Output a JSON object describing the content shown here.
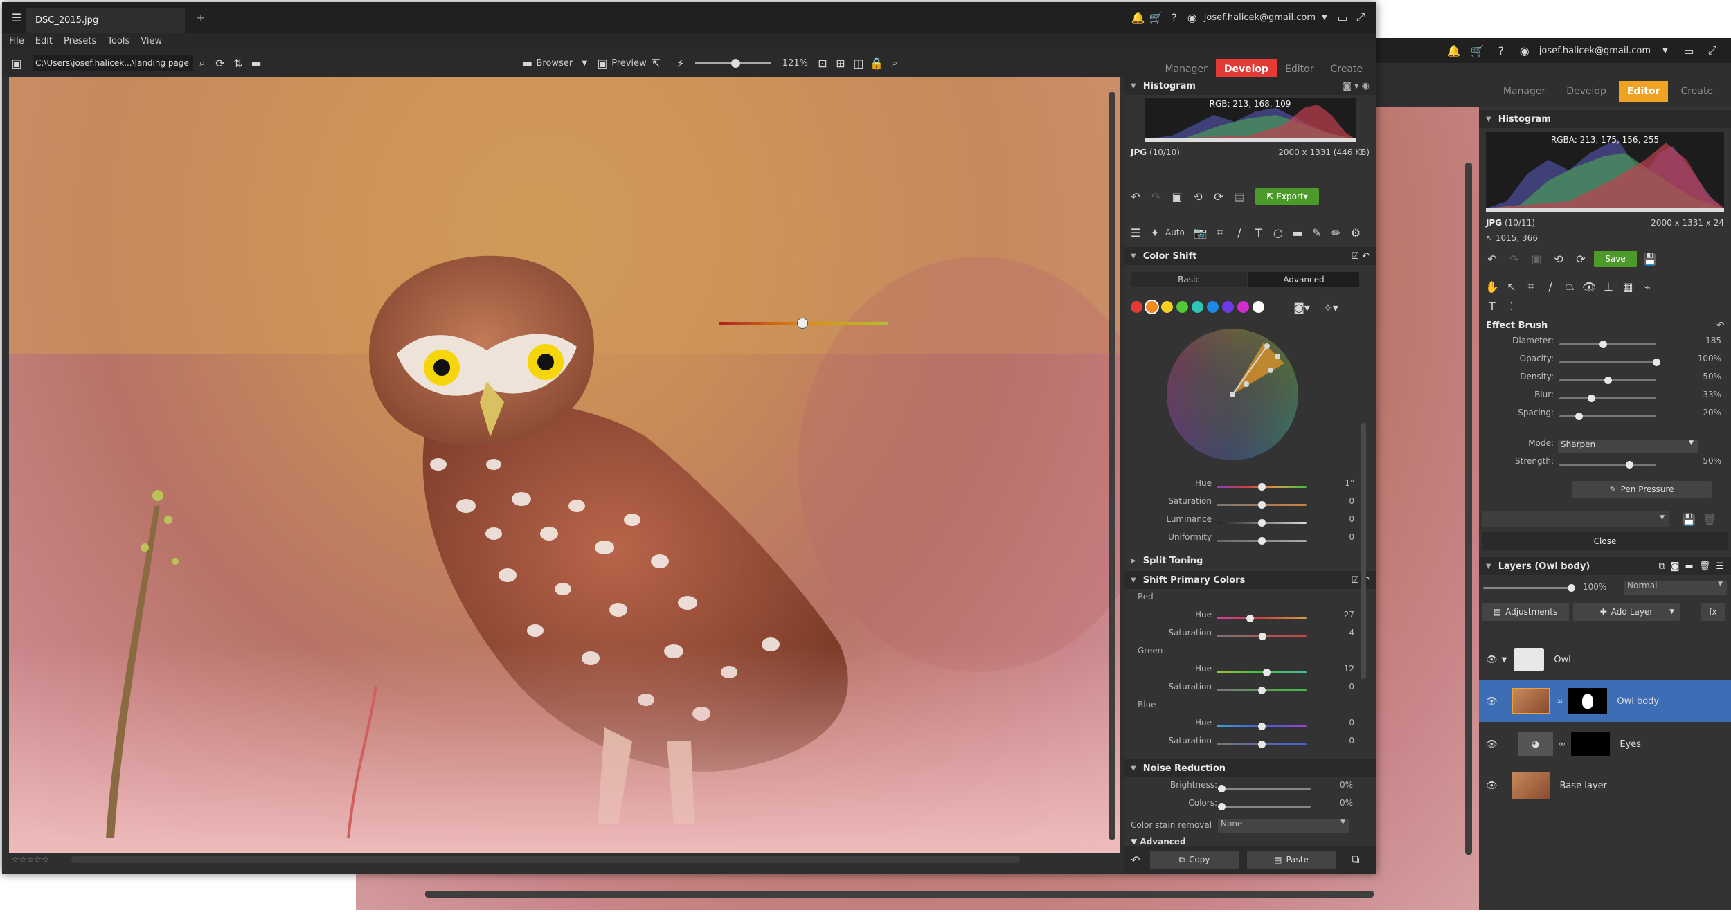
{
  "front": {
    "tab_title": "DSC_2015.jpg",
    "menu": [
      "File",
      "Edit",
      "Presets",
      "Tools",
      "View"
    ],
    "path": "C:\\Users\\josef.halicek...\\landing page",
    "browser_label": "Browser",
    "preview_label": "Preview",
    "zoom": "121%",
    "user": "josef.halicek@gmail.com",
    "modes": [
      "Manager",
      "Develop",
      "Editor",
      "Create"
    ],
    "histogram": {
      "title": "Histogram",
      "rgb": "RGB: 213, 168, 109",
      "format": "JPG",
      "count": "(10/10)",
      "dims": "2000 x 1331 (446 KB)"
    },
    "export_label": "Export",
    "auto_label": "Auto",
    "color_shift": {
      "title": "Color Shift",
      "tabs": [
        "Basic",
        "Advanced"
      ],
      "rows": [
        {
          "label": "Hue",
          "value": "1°",
          "pos": 0.5
        },
        {
          "label": "Saturation",
          "value": "0",
          "pos": 0.5
        },
        {
          "label": "Luminance",
          "value": "0",
          "pos": 0.5
        },
        {
          "label": "Uniformity",
          "value": "0",
          "pos": 0.5
        }
      ],
      "swatches": [
        "#e53935",
        "#f58a1f",
        "#f5d020",
        "#54c93a",
        "#2ec4b6",
        "#1e88e5",
        "#6a3de8",
        "#d12bc9",
        "#ffffff"
      ]
    },
    "split_toning": "Split Toning",
    "shift_primary": {
      "title": "Shift Primary Colors",
      "red": {
        "name": "Red",
        "hue": "-27",
        "hue_pos": 0.37,
        "sat": "4",
        "sat_pos": 0.51
      },
      "green": {
        "name": "Green",
        "hue": "12",
        "hue_pos": 0.55,
        "sat": "0",
        "sat_pos": 0.5
      },
      "blue": {
        "name": "Blue",
        "hue": "0",
        "hue_pos": 0.5,
        "sat": "0",
        "sat_pos": 0.5
      },
      "hue_label": "Hue",
      "sat_label": "Saturation"
    },
    "noise": {
      "title": "Noise Reduction",
      "brightness_label": "Brightness:",
      "brightness": "0%",
      "colors_label": "Colors:",
      "colors": "0%",
      "stain_label": "Color stain removal",
      "stain": "None"
    },
    "advanced_label": "Advanced",
    "copy_label": "Copy",
    "paste_label": "Paste"
  },
  "back": {
    "user": "josef.halicek@gmail.com",
    "modes": [
      "Manager",
      "Develop",
      "Editor",
      "Create"
    ],
    "histogram": {
      "title": "Histogram",
      "rgba": "RGBA: 213, 175, 156, 255",
      "format": "JPG",
      "count": "(10/11)",
      "dims": "2000 x 1331 x 24",
      "coords": "1015, 366"
    },
    "save_label": "Save",
    "effect_brush": {
      "title": "Effect Brush",
      "rows": [
        {
          "label": "Diameter:",
          "value": "185",
          "pos": 0.45
        },
        {
          "label": "Opacity:",
          "value": "100%",
          "pos": 1.0
        },
        {
          "label": "Density:",
          "value": "50%",
          "pos": 0.5
        },
        {
          "label": "Blur:",
          "value": "33%",
          "pos": 0.33
        },
        {
          "label": "Spacing:",
          "value": "20%",
          "pos": 0.2
        }
      ],
      "mode_label": "Mode:",
      "mode": "Sharpen",
      "strength_label": "Strength:",
      "strength": "50%",
      "strength_pos": 0.72,
      "pen_pressure": "Pen Pressure"
    },
    "close_label": "Close",
    "layers": {
      "title": "Layers (Owl body)",
      "opacity": "100%",
      "blend": "Normal",
      "adjustments": "Adjustments",
      "add_layer": "Add Layer",
      "items": [
        {
          "name": "Owl"
        },
        {
          "name": "Owl body"
        },
        {
          "name": "Eyes"
        },
        {
          "name": "Base layer"
        }
      ]
    }
  }
}
